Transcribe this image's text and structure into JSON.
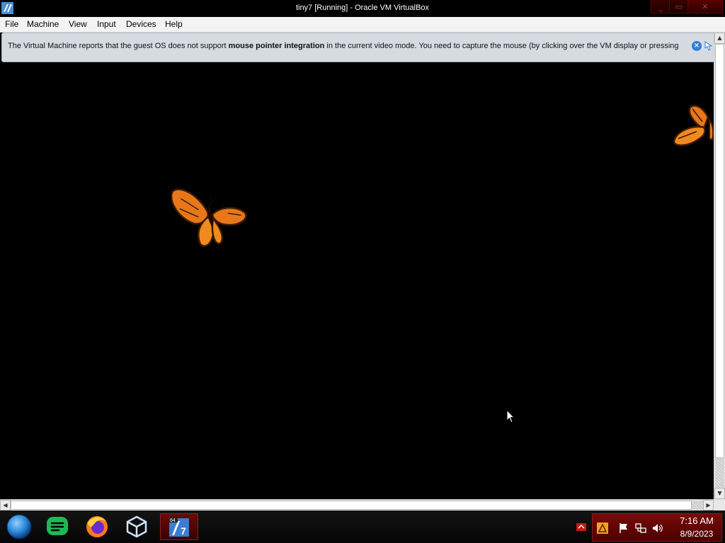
{
  "window": {
    "title": "tiny7 [Running] - Oracle VM VirtualBox",
    "minimize_glyph": "_",
    "maximize_glyph": "▭",
    "close_glyph": "✕"
  },
  "menu": {
    "file": "File",
    "machine": "Machine",
    "view": "View",
    "input": "Input",
    "devices": "Devices",
    "help": "Help"
  },
  "notification": {
    "text_before": "The Virtual Machine reports that the guest OS does not support ",
    "text_bold": "mouse pointer integration",
    "text_after": " in the current video mode. You need to capture the mouse (by clicking over the VM display or pressing",
    "close_glyph": "×"
  },
  "scrollbars": {
    "up": "▲",
    "down": "▼",
    "left": "◀",
    "right": "▶"
  },
  "taskbar": {
    "apps": [
      {
        "name": "start-orb-icon"
      },
      {
        "name": "chat-icon"
      },
      {
        "name": "firefox-icon"
      },
      {
        "name": "virtualbox-icon"
      },
      {
        "name": "tiny7-vm-icon",
        "badge": "64",
        "label": "7"
      }
    ]
  },
  "tray": {
    "time": "7:16 AM",
    "date": "8/9/2023"
  },
  "colors": {
    "taskbar_active": "#6a0a0a",
    "tray": "#7a0a0a",
    "banner": "#d6dbe1",
    "close_blue": "#2f7fd6"
  }
}
